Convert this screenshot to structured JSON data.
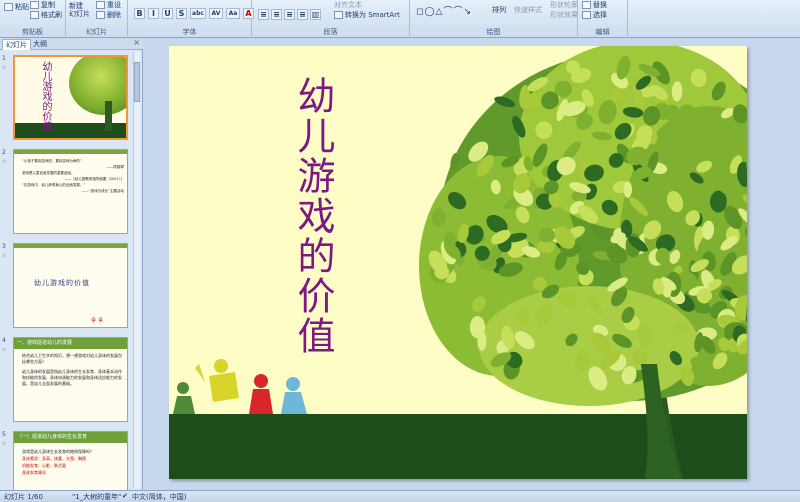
{
  "ribbon": {
    "clipboard": {
      "paste": "粘贴",
      "copy": "复制",
      "format_painter": "格式刷",
      "label": "剪贴板"
    },
    "slides": {
      "new_slide": "新建\n幻灯片",
      "reset": "重设",
      "delete": "删除",
      "label": "幻灯片"
    },
    "font": {
      "label": "字体",
      "buttons": [
        "B",
        "I",
        "U",
        "S",
        "abc",
        "AV",
        "Aa",
        "A"
      ]
    },
    "paragraph": {
      "label": "段落",
      "convert_smartart": "转换为 SmartArt",
      "align_text": "对齐文本"
    },
    "drawing": {
      "label": "绘图",
      "arrange": "排列",
      "quick_styles": "快速样式",
      "shape_effects": "形状效果",
      "shape_outline": "形状轮廓"
    },
    "editing": {
      "label": "编辑",
      "replace": "替换",
      "select": "选择"
    }
  },
  "panel": {
    "tabs": [
      "幻灯片",
      "大纲"
    ],
    "close": "×"
  },
  "thumbnails": [
    {
      "num": "1",
      "title": "幼儿游戏的价值"
    },
    {
      "num": "2",
      "lines": [
        "“小孩子喜欢游戏的，喜欢游戏为命的”",
        "——陈鹤琴",
        "游戏是儿童自身发展的重要途径。",
        "——《幼儿园教育指导纲要（2001）》",
        "“在游戏中，幼儿获得身心的全面发展。”",
        "——“游戏与成长”主题活动"
      ]
    },
    {
      "num": "3",
      "title": "幼儿游戏的价值"
    },
    {
      "num": "4",
      "header": "一、游戏促进幼儿的发展",
      "lines": [
        "结合幼儿卫生学的知识，想一想游戏对幼儿身体的发展包括哪些方面？",
        "幼儿身体的发展是指幼儿身体的生长发育、身体基本动作和技能的发展、身体协调能力的发展和身体适应能力的发展，是幼儿全面发展的基础。"
      ]
    },
    {
      "num": "5",
      "header": "（一）促进幼儿身体的生长发育",
      "lines": [
        "游戏是幼儿身体生长发育的物质保障吗？",
        "身体素质：身高、体重、头围、胸围",
        "机能发育：心脏、肺活量",
        "身体发育情况"
      ]
    }
  ],
  "slide": {
    "title": "幼儿游戏的价值",
    "colors": {
      "background": "#fffdc6",
      "title": "#7b1985",
      "ground": "#1e4d1c",
      "leaf_light": "#a8c93a",
      "leaf_dark": "#2d6b22"
    }
  },
  "status": {
    "slide_counter": "幻灯片 1/60",
    "theme": "\"1_大树的童年\"",
    "language": "中文(简体，中国)"
  }
}
